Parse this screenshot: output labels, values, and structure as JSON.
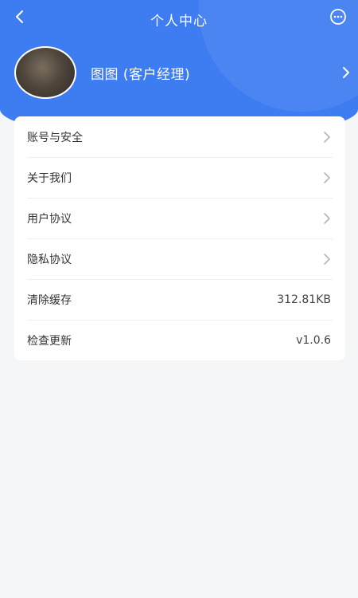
{
  "header": {
    "title": "个人中心",
    "back_icon": "chevron-left-icon",
    "more_icon": "more-dots-icon"
  },
  "profile": {
    "name": "图图 (客户经理)",
    "avatar": "avatar"
  },
  "settings": {
    "items": [
      {
        "label": "账号与安全",
        "value": "",
        "type": "nav"
      },
      {
        "label": "关于我们",
        "value": "",
        "type": "nav"
      },
      {
        "label": "用户协议",
        "value": "",
        "type": "nav"
      },
      {
        "label": "隐私协议",
        "value": "",
        "type": "nav"
      },
      {
        "label": "清除缓存",
        "value": "312.81KB",
        "type": "value"
      },
      {
        "label": "检查更新",
        "value": "v1.0.6",
        "type": "value"
      }
    ]
  },
  "colors": {
    "header_blue": "#3e7cf2",
    "background": "#f5f6f8",
    "card": "#ffffff",
    "text": "#333333",
    "chevron": "#b5b5b5"
  }
}
